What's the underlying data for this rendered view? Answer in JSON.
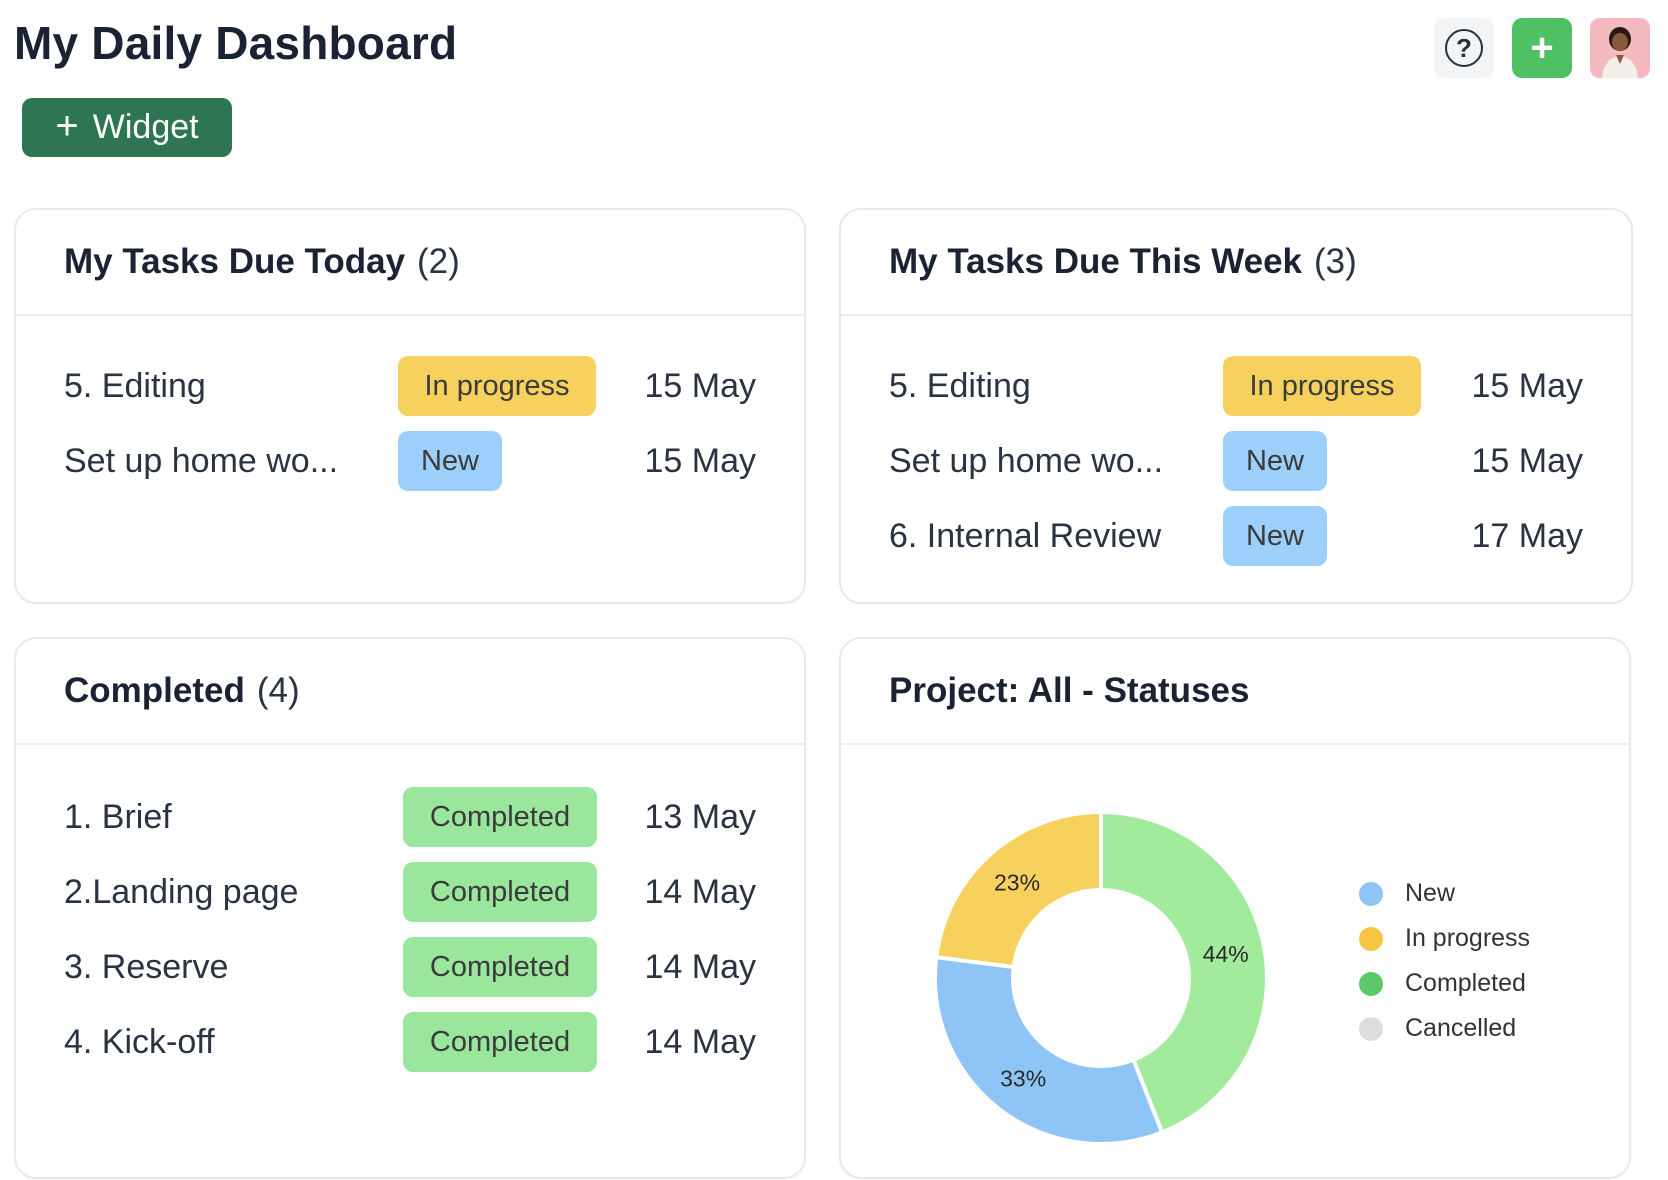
{
  "header": {
    "title": "My Daily Dashboard",
    "widget_button": "Widget",
    "help_icon": "question-icon",
    "add_icon": "plus-icon"
  },
  "cards": {
    "today": {
      "title": "My Tasks Due Today",
      "count": "(2)",
      "tasks": [
        {
          "name": "5. Editing",
          "status": "In progress",
          "date": "15 May"
        },
        {
          "name": "Set up home wo...",
          "status": "New",
          "date": "15 May"
        }
      ]
    },
    "week": {
      "title": "My Tasks Due This Week",
      "count": "(3)",
      "tasks": [
        {
          "name": "5. Editing",
          "status": "In progress",
          "date": "15 May"
        },
        {
          "name": "Set up home wo...",
          "status": "New",
          "date": "15 May"
        },
        {
          "name": "6. Internal Review",
          "status": "New",
          "date": "17 May"
        }
      ]
    },
    "completed": {
      "title": "Completed",
      "count": "(4)",
      "tasks": [
        {
          "name": "1. Brief",
          "status": "Completed",
          "date": "13 May"
        },
        {
          "name": "2.Landing page",
          "status": "Completed",
          "date": "14 May"
        },
        {
          "name": "3. Reserve",
          "status": "Completed",
          "date": "14 May"
        },
        {
          "name": "4. Kick-off",
          "status": "Completed",
          "date": "14 May"
        }
      ]
    },
    "statuses": {
      "title": "Project: All - Statuses"
    }
  },
  "colors": {
    "accent": "#2e7553",
    "add": "#4fc164",
    "in_progress": "#f7d15d",
    "new": "#9dcffb",
    "completed": "#9ae69c"
  },
  "chart_data": {
    "type": "pie",
    "categories": [
      "New",
      "In progress",
      "Completed",
      "Cancelled"
    ],
    "values": [
      33,
      23,
      44,
      0
    ],
    "labels": [
      "33%",
      "23%",
      "44%",
      ""
    ],
    "colors": [
      "#8ec5f6",
      "#f7d15d",
      "#a3eb9c",
      "#dedede"
    ],
    "legend_colors": [
      "#8ec5f6",
      "#f7c542",
      "#5bc86a",
      "#dedede"
    ],
    "legend_position": "right"
  }
}
